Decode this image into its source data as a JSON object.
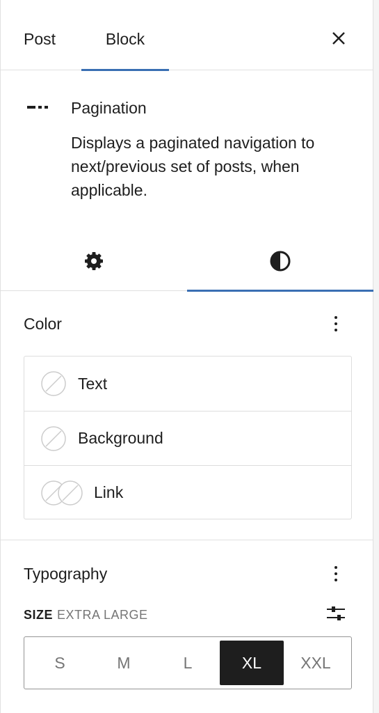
{
  "header": {
    "tabs": [
      {
        "label": "Post"
      },
      {
        "label": "Block"
      }
    ],
    "active_tab": "Block",
    "close_icon": "close-icon"
  },
  "block": {
    "icon": "pagination-icon",
    "title": "Pagination",
    "description": "Displays a paginated navigation to next/previous set of posts, when applicable."
  },
  "inspector_tabs": {
    "settings_icon": "gear-icon",
    "styles_icon": "half-circle-icon",
    "active": "styles"
  },
  "color": {
    "title": "Color",
    "items": [
      {
        "label": "Text",
        "swatch": "empty-swatch-icon"
      },
      {
        "label": "Background",
        "swatch": "empty-swatch-icon"
      },
      {
        "label": "Link",
        "swatch": "double-empty-swatch-icon"
      }
    ]
  },
  "typography": {
    "title": "Typography",
    "size_label": "SIZE",
    "size_value": "EXTRA LARGE",
    "custom_icon": "sliders-icon",
    "sizes": [
      "S",
      "M",
      "L",
      "XL",
      "XXL"
    ],
    "selected_size": "XL"
  },
  "colors": {
    "accent": "#3a6fb3",
    "text": "#1e1e1e",
    "muted": "#757575",
    "border": "#e0e0e0"
  }
}
